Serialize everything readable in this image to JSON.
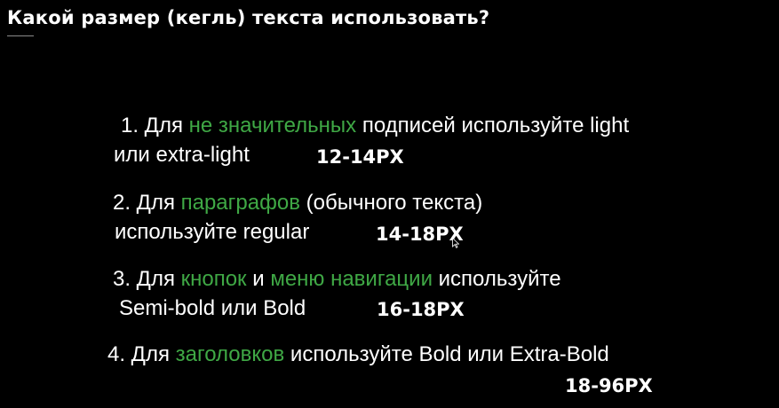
{
  "title": "Какой размер (кегль) текста использовать?",
  "items": [
    {
      "line1": {
        "p1": "1. Для ",
        "h1": "не значительных",
        "p2": " подписей используйте light"
      },
      "line2": "или extra-light",
      "size": "12-14PX"
    },
    {
      "line1": {
        "p1": "2. Для ",
        "h1": "параграфов",
        "p2": " (обычного текста)"
      },
      "line2": "используйте regular",
      "size": "14-18PX"
    },
    {
      "line1": {
        "p1": "3. Для ",
        "h1": "кнопок",
        "p2": " и ",
        "h2": "меню навигации",
        "p3": " используйте"
      },
      "line2": "Semi-bold или Bold",
      "size": "16-18PX"
    },
    {
      "line1": {
        "p1": "4. Для ",
        "h1": "заголовков",
        "p2": " используйте  Bold или Extra-Bold"
      },
      "size": "18-96PX"
    }
  ],
  "colors": {
    "background": "#000000",
    "text": "#ffffff",
    "highlight": "#3fa845"
  },
  "icons": {
    "cursor": "mouse-pointer-icon"
  }
}
